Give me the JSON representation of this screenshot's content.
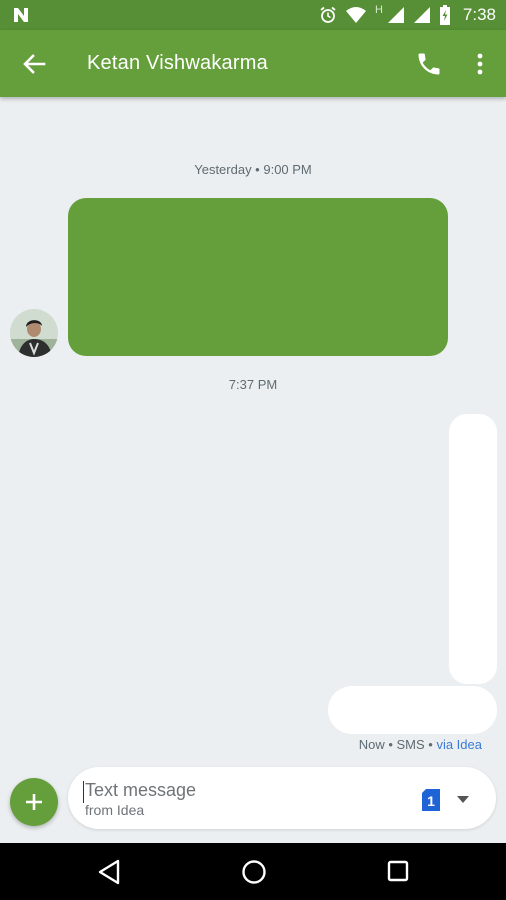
{
  "status_bar": {
    "time": "7:38",
    "network_label": "H",
    "icons": [
      "n-notification-icon",
      "alarm-icon",
      "wifi-icon",
      "signal-icon",
      "battery-icon"
    ]
  },
  "app_bar": {
    "title": "Ketan Vishwakarma",
    "icons": [
      "back-arrow-icon",
      "phone-icon",
      "more-vert-icon"
    ],
    "color": "#659f3b"
  },
  "conversation": {
    "timestamp_1": "Yesterday • 9:00 PM",
    "timestamp_2": "7:37 PM",
    "sent_meta": {
      "time_type": "Now • SMS • ",
      "via": "via Idea"
    }
  },
  "composer": {
    "placeholder": "Text message",
    "sub_label": "from Idea",
    "sim_badge": "1",
    "add_icon": "plus-icon",
    "dropdown_icon": "chevron-down-icon"
  },
  "nav_bar": {
    "icons": [
      "nav-back-icon",
      "nav-home-icon",
      "nav-recents-icon"
    ]
  },
  "colors": {
    "accent": "#659f3b",
    "status_bar": "#568f35",
    "link": "#3b7bd4",
    "background": "#eceff1"
  }
}
